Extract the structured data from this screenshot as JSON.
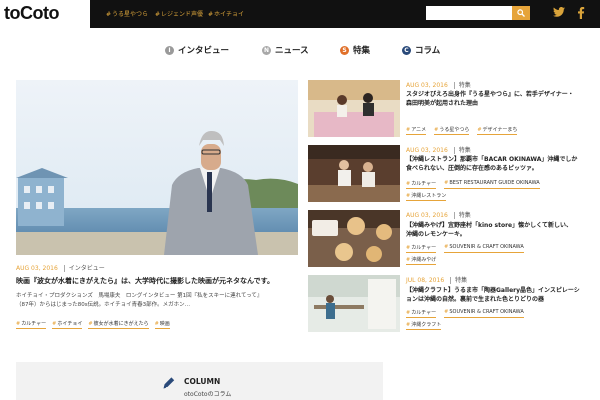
{
  "header": {
    "logo": "toCoto",
    "nav": [
      {
        "label": "うる星やつら"
      },
      {
        "label": "レジェンド声優"
      },
      {
        "label": "ホイチョイ"
      }
    ],
    "search": {
      "placeholder": ""
    }
  },
  "main_nav": [
    {
      "label": "インタビュー",
      "badge": "I",
      "color": "#9a9a9a"
    },
    {
      "label": "ニュース",
      "badge": "N",
      "color": "#a8a8a8"
    },
    {
      "label": "特集",
      "badge": "S",
      "color": "#e0702a"
    },
    {
      "label": "コラム",
      "badge": "C",
      "color": "#2a4a7a"
    }
  ],
  "featured": {
    "date": "AUG 03, 2016",
    "category": "インタビュー",
    "title": "映画『波女が水着にきがえたら』は、大学時代に撮影した映画が元ネタなんです。",
    "excerpt_line1": "ホイチョイ・プロダクションズ　馬場康夫　ロングインタビュー 第1回『私をスキーに連れてって』",
    "excerpt_line2": "（87年）からはじまった80s伝説。ホイチョイ青春3部作。メガホン…",
    "tags": [
      "カルチャー",
      "ホイチョイ",
      "彼女が水着にきがえたら",
      "映画"
    ]
  },
  "articles": [
    {
      "date": "AUG 03, 2016",
      "category": "特集",
      "title1": "スタジオぴえろ出身作『うる星やつら』に、若手デザイナー・",
      "title2": "森田明美が起用された理由",
      "tags": [
        "アニメ",
        "うる星やつら",
        "デザイナーまち"
      ]
    },
    {
      "date": "AUG 03, 2016",
      "category": "特集",
      "title1": "【沖縄レストラン】那覇市「BACAR OKINAWA」沖縄でしか",
      "title2": "食べられない、圧倒的に存在感のあるピッツァ。",
      "tags": [
        "カルチャー",
        "BEST RESTAURANT GUIDE OKINAWA",
        "沖縄レストラン"
      ]
    },
    {
      "date": "AUG 03, 2016",
      "category": "特集",
      "title1": "【沖縄みやげ】宜野座村「kino store」懐かしくて新しい、",
      "title2": "沖縄のレモンケーキ。",
      "tags": [
        "カルチャー",
        "SOUVENIR & CRAFT OKINAWA",
        "沖縄みやげ"
      ]
    },
    {
      "date": "JUL 08, 2016",
      "category": "特集",
      "title1": "【沖縄クラフト】うるま市「陶器Gallery晶色」インスピレーシ",
      "title2": "ョンは沖縄の自然。裏前で生まれた色とりどりの器",
      "tags": [
        "カルチャー",
        "SOUVENIR & CRAFT OKINAWA",
        "沖縄クラフト"
      ]
    }
  ],
  "column": {
    "title": "COLUMN",
    "subtitle": "otoCotoのコラム"
  },
  "colors": {
    "accent": "#e6a43a",
    "header_bg": "#111111"
  }
}
